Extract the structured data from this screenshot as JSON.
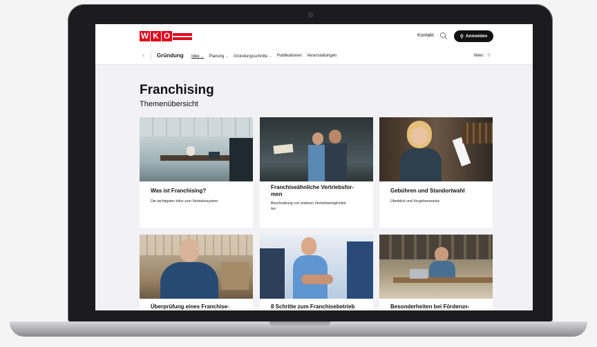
{
  "header": {
    "logo_letters": [
      "W",
      "K",
      "O"
    ],
    "contact_label": "Kontakt",
    "login_label": "Anmelden"
  },
  "nav": {
    "title": "Gründung",
    "items": [
      {
        "label": "Idee",
        "chevron": true,
        "active": true
      },
      {
        "label": "Planung",
        "chevron": true,
        "active": false
      },
      {
        "label": "Gründungsschritte",
        "chevron": true,
        "active": false
      },
      {
        "label": "Publikationen",
        "chevron": false,
        "active": false
      },
      {
        "label": "Veranstaltungen",
        "chevron": false,
        "active": false
      }
    ],
    "region": "Wien"
  },
  "page": {
    "title": "Franchising",
    "subtitle": "Themenübersicht"
  },
  "cards": [
    {
      "title": "Was ist Franchising?",
      "desc": "Die wichtigsten Infos zum Vertriebssystem"
    },
    {
      "title": "Franchiseähnliche Vertriebsfor-\nmen",
      "desc": "Beschreibung von anderen Vertriebsmöglichkei-\nten"
    },
    {
      "title": "Gebühren und Standortwahl",
      "desc": "Überblick und Vorgehensweise"
    },
    {
      "title": "Überprüfung eines Franchise-",
      "desc": ""
    },
    {
      "title": "8 Schritte zum Franchisebetrieb",
      "desc": ""
    },
    {
      "title": "Besonderheiten bei Förderun-",
      "desc": ""
    }
  ],
  "colors": {
    "brand_red": "#e2001a",
    "button_black": "#111111",
    "page_background": "#f2f2f4"
  }
}
